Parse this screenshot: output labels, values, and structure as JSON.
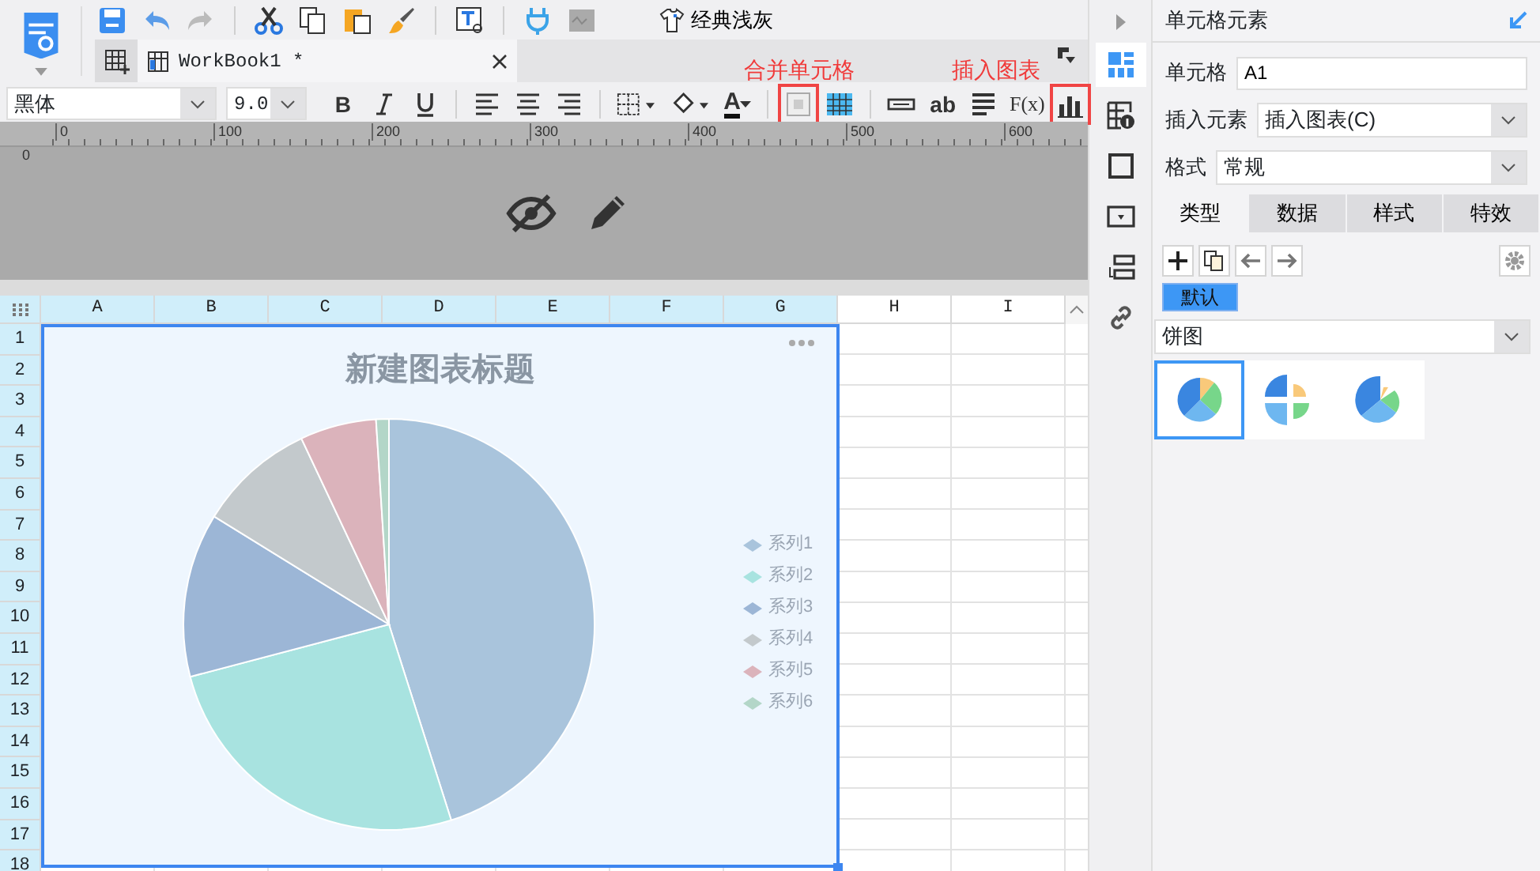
{
  "toolbar": {
    "theme_button": "经典浅灰"
  },
  "document_tabs": [
    {
      "label": "WorkBook1 *",
      "selected": true
    }
  ],
  "format_bar": {
    "font": "黑体",
    "size": "9.0",
    "buttons": [
      {
        "kind": "bold",
        "label": "B",
        "highlighted": false
      },
      {
        "kind": "italic",
        "highlighted": false
      },
      {
        "kind": "underline",
        "highlighted": false
      },
      {
        "kind": "sep"
      },
      {
        "kind": "align-left",
        "highlighted": false
      },
      {
        "kind": "align-center",
        "highlighted": false
      },
      {
        "kind": "align-right",
        "highlighted": false
      },
      {
        "kind": "sep"
      },
      {
        "kind": "border",
        "highlighted": false
      },
      {
        "kind": "fill",
        "highlighted": false
      },
      {
        "kind": "font-color",
        "label": "A",
        "highlighted": false
      },
      {
        "kind": "sep"
      },
      {
        "kind": "merge",
        "highlighted": true
      },
      {
        "kind": "grid",
        "highlighted": false
      },
      {
        "kind": "sep"
      },
      {
        "kind": "field",
        "highlighted": false
      },
      {
        "kind": "ab",
        "label": "ab",
        "highlighted": false
      },
      {
        "kind": "lines",
        "highlighted": false
      },
      {
        "kind": "formula",
        "label": "F(x)",
        "highlighted": false
      },
      {
        "kind": "chart",
        "highlighted": true
      }
    ]
  },
  "annotations": [
    {
      "text": "合并单元格"
    },
    {
      "text": "插入图表"
    }
  ],
  "ruler": {
    "ticks": [
      "0",
      "100",
      "200",
      "300",
      "400",
      "500",
      "600"
    ],
    "vertical": "0"
  },
  "sheet": {
    "columns": [
      {
        "label": "A",
        "selected": true
      },
      {
        "label": "B",
        "selected": true
      },
      {
        "label": "C",
        "selected": true
      },
      {
        "label": "D",
        "selected": true
      },
      {
        "label": "E",
        "selected": true
      },
      {
        "label": "F",
        "selected": true
      },
      {
        "label": "G",
        "selected": true
      },
      {
        "label": "H",
        "selected": false
      },
      {
        "label": "I",
        "selected": false
      }
    ],
    "rows": [
      {
        "label": "1",
        "selected": true
      },
      {
        "label": "2",
        "selected": true
      },
      {
        "label": "3",
        "selected": true
      },
      {
        "label": "4",
        "selected": true
      },
      {
        "label": "5",
        "selected": true
      },
      {
        "label": "6",
        "selected": true
      },
      {
        "label": "7",
        "selected": true
      },
      {
        "label": "8",
        "selected": true
      },
      {
        "label": "9",
        "selected": true
      },
      {
        "label": "10",
        "selected": true
      },
      {
        "label": "11",
        "selected": true
      },
      {
        "label": "12",
        "selected": true
      },
      {
        "label": "13",
        "selected": true
      },
      {
        "label": "14",
        "selected": true
      },
      {
        "label": "15",
        "selected": true
      },
      {
        "label": "16",
        "selected": true
      },
      {
        "label": "17",
        "selected": true
      },
      {
        "label": "18",
        "selected": true
      }
    ]
  },
  "chart": {
    "title": "新建图表标题",
    "legend": [
      {
        "name": "系列1",
        "color": "#a9c4dc"
      },
      {
        "name": "系列2",
        "color": "#a8e3e0"
      },
      {
        "name": "系列3",
        "color": "#9cb6d6"
      },
      {
        "name": "系列4",
        "color": "#c3c9cc"
      },
      {
        "name": "系列5",
        "color": "#dbb3bb"
      },
      {
        "name": "系列6",
        "color": "#b3d6c8"
      }
    ]
  },
  "side_icons": [
    {
      "kind": "cell",
      "selected": true
    },
    {
      "kind": "attr",
      "selected": false
    },
    {
      "kind": "frame",
      "selected": false
    },
    {
      "kind": "widget",
      "selected": false
    },
    {
      "kind": "list",
      "selected": false
    },
    {
      "kind": "link",
      "selected": false
    }
  ],
  "panel": {
    "title": "单元格元素",
    "fields": [
      {
        "label": "单元格",
        "value": "A1",
        "kind": "input"
      },
      {
        "label": "插入元素",
        "value": "插入图表(C)",
        "kind": "select"
      },
      {
        "label": "格式",
        "value": "常规",
        "kind": "select"
      }
    ],
    "tabs": [
      {
        "label": "类型",
        "selected": true
      },
      {
        "label": "数据",
        "selected": false
      },
      {
        "label": "样式",
        "selected": false
      },
      {
        "label": "特效",
        "selected": false
      }
    ],
    "series_tags": [
      {
        "label": "默认",
        "selected": true
      }
    ],
    "chart_type": "饼图",
    "variants": [
      {
        "kind": "pie",
        "selected": true
      },
      {
        "kind": "split",
        "selected": false
      },
      {
        "kind": "rose",
        "selected": false
      }
    ]
  }
}
